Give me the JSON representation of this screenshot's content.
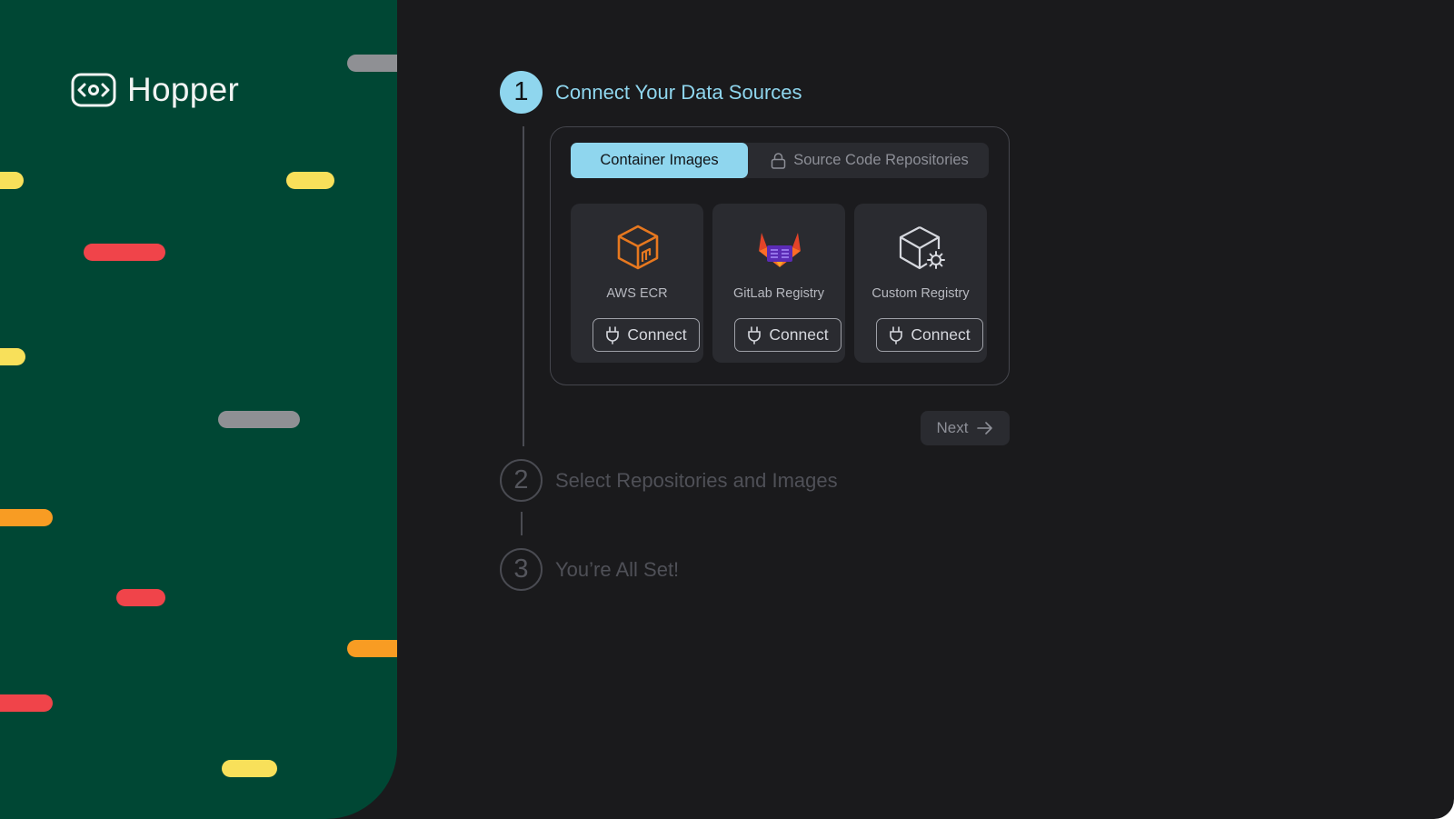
{
  "brand": {
    "name": "Hopper",
    "panel_color": "#004734",
    "pill_colors": {
      "yellow": "#f8e05a",
      "red": "#f0444a",
      "gray": "#8f9094",
      "orange": "#f89c23"
    }
  },
  "accent_color": "#8fd6ee",
  "steps": [
    {
      "number": "1",
      "title": "Connect Your Data Sources",
      "state": "active"
    },
    {
      "number": "2",
      "title": "Select Repositories and Images",
      "state": "inactive"
    },
    {
      "number": "3",
      "title": "You’re All Set!",
      "state": "inactive"
    }
  ],
  "tabs": [
    {
      "label": "Container Images",
      "selected": true,
      "icon": null
    },
    {
      "label": "Source Code Repositories",
      "selected": false,
      "icon": "lock-icon"
    }
  ],
  "providers": [
    {
      "name": "AWS ECR",
      "icon": "aws-ecr-icon",
      "button_label": "Connect",
      "button_icon": "plug-icon"
    },
    {
      "name": "GitLab Registry",
      "icon": "gitlab-icon",
      "button_label": "Connect",
      "button_icon": "plug-icon"
    },
    {
      "name": "Custom Registry",
      "icon": "box-gear-icon",
      "button_label": "Connect",
      "button_icon": "plug-icon"
    }
  ],
  "next_button": {
    "label": "Next",
    "icon": "arrow-right-icon",
    "enabled": false
  }
}
